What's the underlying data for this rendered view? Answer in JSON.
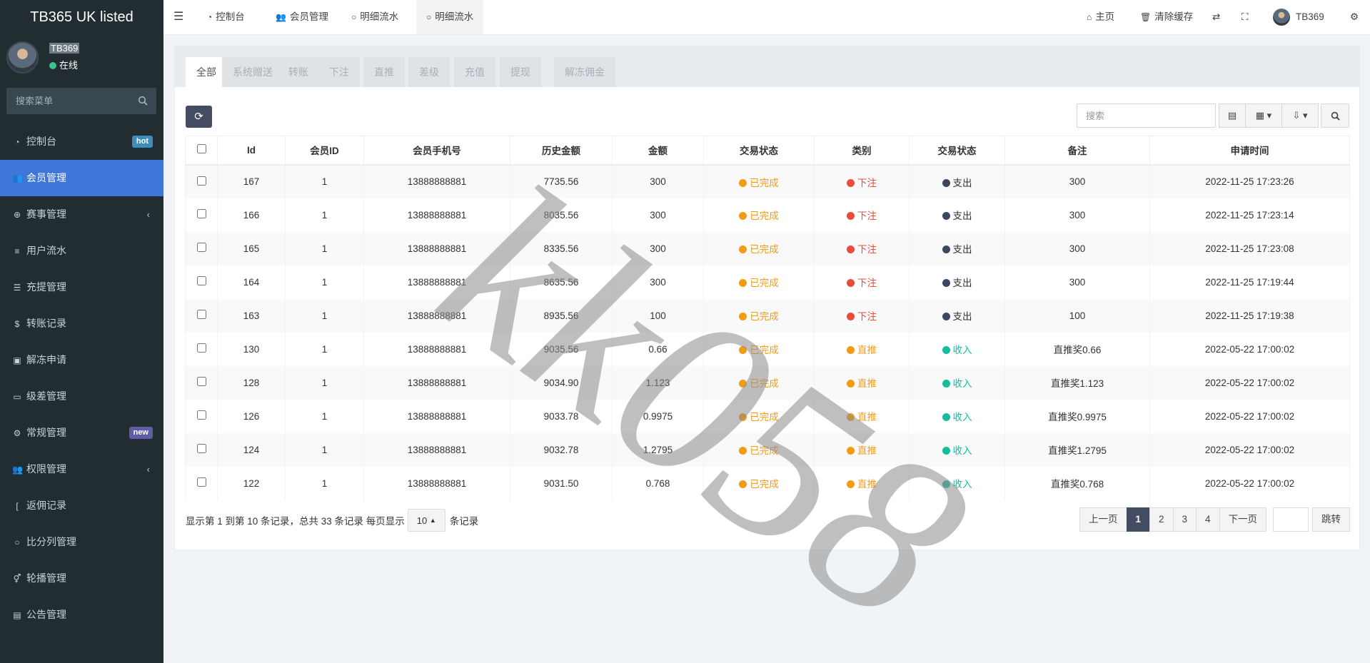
{
  "brand": "TB365 UK listed",
  "user": {
    "name": "TB369",
    "status": "在线"
  },
  "sidebar": {
    "search_placeholder": "搜索菜单",
    "items": [
      {
        "label": "控制台",
        "icon": "dashboard-icon",
        "badge": "hot"
      },
      {
        "label": "会员管理",
        "icon": "users-icon",
        "active": true
      },
      {
        "label": "赛事管理",
        "icon": "globe-icon",
        "chevron": "‹"
      },
      {
        "label": "用户流水",
        "icon": "list-icon"
      },
      {
        "label": "充提管理",
        "icon": "list-alt-icon"
      },
      {
        "label": "转账记录",
        "icon": "money-icon"
      },
      {
        "label": "解冻申请",
        "icon": "image-icon"
      },
      {
        "label": "级差管理",
        "icon": "window-icon"
      },
      {
        "label": "常规管理",
        "icon": "cogs-icon",
        "badge": "new"
      },
      {
        "label": "权限管理",
        "icon": "users-icon",
        "chevron": "‹"
      },
      {
        "label": "返佣记录",
        "icon": "bracket-icon"
      },
      {
        "label": "比分列管理",
        "icon": "circle-icon"
      },
      {
        "label": "轮播管理",
        "icon": "venus-mars-icon"
      },
      {
        "label": "公告管理",
        "icon": "newspaper-icon"
      }
    ]
  },
  "topbar": {
    "nav": [
      "控制台",
      "会员管理",
      "明细流水",
      "明细流水"
    ],
    "right": {
      "home": "主页",
      "clear_cache": "清除缓存",
      "username": "TB369"
    }
  },
  "filter_tabs": [
    "全部",
    "系统赠送",
    "转账",
    "下注",
    "直推",
    "差级",
    "充值",
    "提现",
    "解冻佣金"
  ],
  "toolbar": {
    "search_placeholder": "搜索"
  },
  "table": {
    "headers": [
      "Id",
      "会员ID",
      "会员手机号",
      "历史金额",
      "金额",
      "交易状态",
      "类别",
      "交易状态",
      "备注",
      "申请时间"
    ],
    "rows": [
      {
        "id": "167",
        "member_id": "1",
        "phone": "13888888881",
        "history": "7735.56",
        "amount": "300",
        "status": "已完成",
        "category": "下注",
        "flow": "支出",
        "note": "300",
        "time": "2022-11-25 17:23:26"
      },
      {
        "id": "166",
        "member_id": "1",
        "phone": "13888888881",
        "history": "8035.56",
        "amount": "300",
        "status": "已完成",
        "category": "下注",
        "flow": "支出",
        "note": "300",
        "time": "2022-11-25 17:23:14"
      },
      {
        "id": "165",
        "member_id": "1",
        "phone": "13888888881",
        "history": "8335.56",
        "amount": "300",
        "status": "已完成",
        "category": "下注",
        "flow": "支出",
        "note": "300",
        "time": "2022-11-25 17:23:08"
      },
      {
        "id": "164",
        "member_id": "1",
        "phone": "13888888881",
        "history": "8635.56",
        "amount": "300",
        "status": "已完成",
        "category": "下注",
        "flow": "支出",
        "note": "300",
        "time": "2022-11-25 17:19:44"
      },
      {
        "id": "163",
        "member_id": "1",
        "phone": "13888888881",
        "history": "8935.56",
        "amount": "100",
        "status": "已完成",
        "category": "下注",
        "flow": "支出",
        "note": "100",
        "time": "2022-11-25 17:19:38"
      },
      {
        "id": "130",
        "member_id": "1",
        "phone": "13888888881",
        "history": "9035.56",
        "amount": "0.66",
        "status": "已完成",
        "category": "直推",
        "flow": "收入",
        "note": "直推奖0.66",
        "time": "2022-05-22 17:00:02"
      },
      {
        "id": "128",
        "member_id": "1",
        "phone": "13888888881",
        "history": "9034.90",
        "amount": "1.123",
        "status": "已完成",
        "category": "直推",
        "flow": "收入",
        "note": "直推奖1.123",
        "time": "2022-05-22 17:00:02"
      },
      {
        "id": "126",
        "member_id": "1",
        "phone": "13888888881",
        "history": "9033.78",
        "amount": "0.9975",
        "status": "已完成",
        "category": "直推",
        "flow": "收入",
        "note": "直推奖0.9975",
        "time": "2022-05-22 17:00:02"
      },
      {
        "id": "124",
        "member_id": "1",
        "phone": "13888888881",
        "history": "9032.78",
        "amount": "1.2795",
        "status": "已完成",
        "category": "直推",
        "flow": "收入",
        "note": "直推奖1.2795",
        "time": "2022-05-22 17:00:02"
      },
      {
        "id": "122",
        "member_id": "1",
        "phone": "13888888881",
        "history": "9031.50",
        "amount": "0.768",
        "status": "已完成",
        "category": "直推",
        "flow": "收入",
        "note": "直推奖0.768",
        "time": "2022-05-22 17:00:02"
      }
    ]
  },
  "footer": {
    "info": "显示第 1 到第 10 条记录，总共 33 条记录 每页显示",
    "page_size": "10",
    "suffix": "条记录",
    "prev": "上一页",
    "pages": [
      "1",
      "2",
      "3",
      "4"
    ],
    "current_page": "1",
    "next": "下一页",
    "jump": "跳转"
  },
  "watermark": "kk058",
  "colors": {
    "sidebar": "#222d32",
    "active_menu": "#3f76d8",
    "primary_btn": "#444c61",
    "complete": "#f39c12",
    "bet": "#e74c3c",
    "expense": "#3b4660",
    "income": "#18bc9c"
  }
}
